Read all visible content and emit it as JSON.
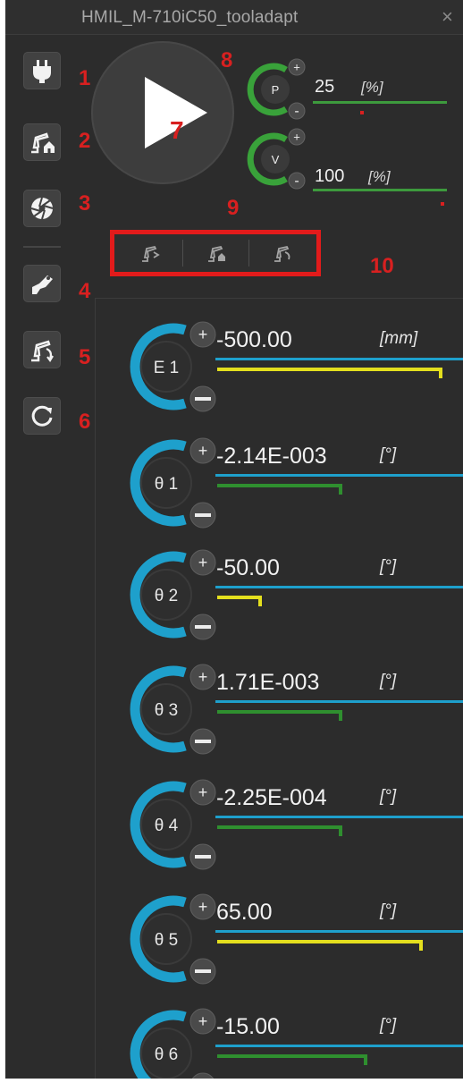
{
  "window": {
    "title": "HMIL_M-710iC50_tooladapt",
    "close_glyph": "×"
  },
  "toolbar": {
    "buttons": [
      {
        "icon": "power-plug-icon",
        "label": "1"
      },
      {
        "icon": "robot-home-icon",
        "label": "2"
      },
      {
        "icon": "shutter-icon",
        "label": "3"
      },
      {
        "icon": "tool-arm-icon",
        "label": "4"
      },
      {
        "icon": "robot-motion-icon",
        "label": "5"
      },
      {
        "icon": "refresh-icon",
        "label": "6"
      }
    ]
  },
  "play": {
    "icon": "play-icon",
    "label": "7"
  },
  "speed": [
    {
      "name": "P",
      "value": "25",
      "unit": "[%]",
      "fraction": 0.25,
      "label": "8"
    },
    {
      "name": "V",
      "value": "100",
      "unit": "[%]",
      "fraction": 1.0,
      "label": "9"
    }
  ],
  "frames": {
    "label": "10",
    "buttons": [
      {
        "icon": "world-frame-icon"
      },
      {
        "icon": "base-frame-icon"
      },
      {
        "icon": "tool-frame-icon"
      }
    ]
  },
  "joints": [
    {
      "name": "E 1",
      "value": "-500.00",
      "unit": "[mm]",
      "fraction": 0.9,
      "bar_color": "#e4df1e"
    },
    {
      "name": "θ 1",
      "value": "-2.14E-003",
      "unit": "[°]",
      "fraction": 0.5,
      "bar_color": "#2f8f2f"
    },
    {
      "name": "θ 2",
      "value": "-50.00",
      "unit": "[°]",
      "fraction": 0.18,
      "bar_color": "#e4df1e"
    },
    {
      "name": "θ 3",
      "value": "1.71E-003",
      "unit": "[°]",
      "fraction": 0.5,
      "bar_color": "#2f8f2f"
    },
    {
      "name": "θ 4",
      "value": "-2.25E-004",
      "unit": "[°]",
      "fraction": 0.5,
      "bar_color": "#2f8f2f"
    },
    {
      "name": "θ 5",
      "value": "65.00",
      "unit": "[°]",
      "fraction": 0.82,
      "bar_color": "#e4df1e"
    },
    {
      "name": "θ 6",
      "value": "-15.00",
      "unit": "[°]",
      "fraction": 0.6,
      "bar_color": "#2f8f2f"
    }
  ],
  "colors": {
    "panel_bg": "#2c2c2c",
    "annotation_red": "#d82020",
    "joint_blue": "#1ea0cc",
    "speed_green": "#3d9a3d",
    "limit_yellow": "#e4df1e"
  }
}
